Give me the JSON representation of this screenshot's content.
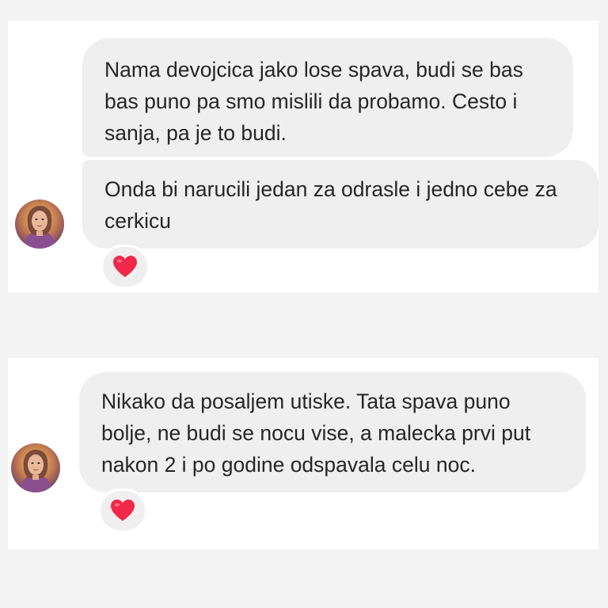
{
  "conversation_top": {
    "messages": [
      {
        "text": "Nama devojcica jako lose spava, budi se bas bas puno pa smo mislili da probamo. Cesto i sanja, pa je to budi."
      },
      {
        "text": "Onda bi narucili jedan za odrasle i jedno cebe za cerkicu",
        "reaction": "heart"
      }
    ],
    "avatar": "contact-avatar"
  },
  "conversation_bottom": {
    "messages": [
      {
        "text": "Nikako da posaljem utiske. Tata spava puno bolje, ne budi se nocu vise, a malecka prvi put nakon 2 i po godine odspavala celu noc.",
        "reaction": "heart"
      }
    ],
    "avatar": "contact-avatar"
  },
  "colors": {
    "page_background": "#f3f3f3",
    "card_background": "#ffffff",
    "bubble_background": "#efefef",
    "text": "#262626",
    "heart": "#f0284a"
  }
}
